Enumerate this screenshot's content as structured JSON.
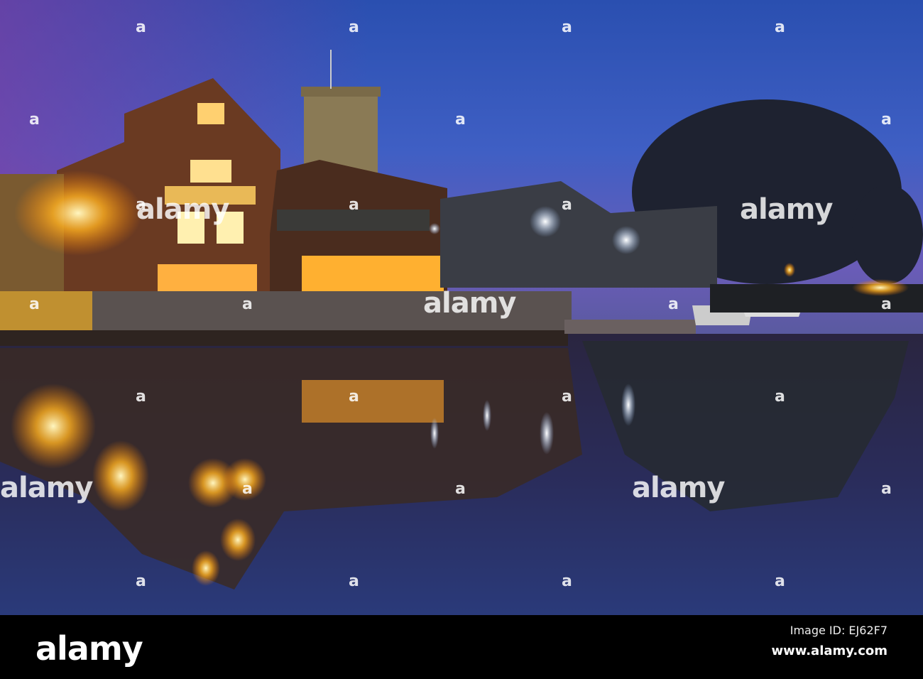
{
  "photo": {
    "subject": "Riverside buildings at dusk with reflections",
    "watermark_text": "alamy",
    "watermark_letter": "a"
  },
  "footer": {
    "logo": "alamy",
    "image_id": "Image ID: EJ62F7",
    "url": "www.alamy.com"
  }
}
